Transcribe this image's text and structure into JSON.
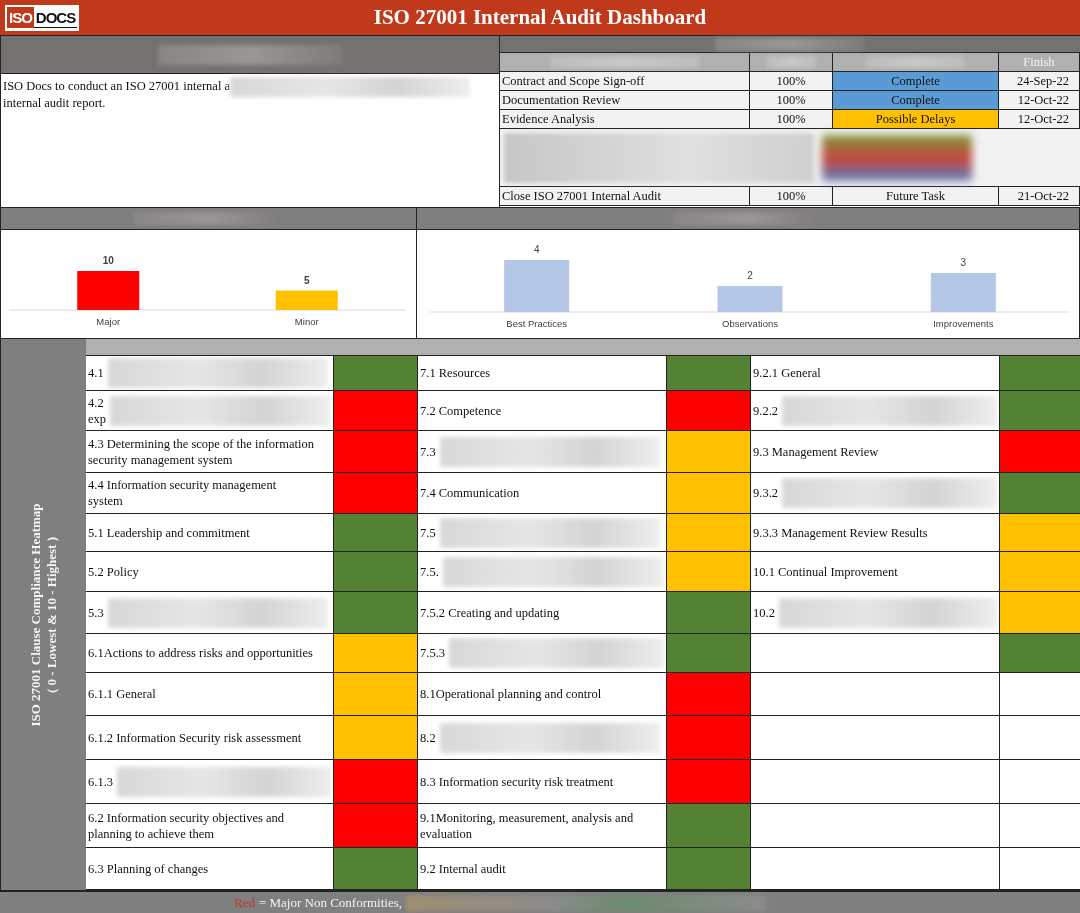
{
  "header": {
    "logo": {
      "mark": "ISO",
      "word": "DOCS"
    },
    "title": "ISO 27001 Internal Audit Dashboard"
  },
  "scope_panel": {
    "title_redacted": true,
    "lines": [
      {
        "text": "ISO Docs to conduct an ISO 27001 internal a",
        "redacted": true
      },
      {
        "text": "internal audit report."
      }
    ]
  },
  "task_table": {
    "title_redacted": true,
    "columns": [
      {
        "redacted": true
      },
      {
        "redacted": true
      },
      {
        "redacted": true
      },
      {
        "label": "Finish"
      }
    ],
    "rows": [
      {
        "kind": "task",
        "task": "Contract and Scope Sign-off",
        "progress": "100%",
        "status": "Complete",
        "color": "#5b9bd5",
        "finish": "24-Sep-22"
      },
      {
        "kind": "task",
        "task": "Documentation Review",
        "progress": "100%",
        "status": "Complete",
        "color": "#5b9bd5",
        "finish": "12-Oct-22"
      },
      {
        "kind": "task",
        "task": "Evidence Analysis",
        "progress": "100%",
        "status": "Possible Delays",
        "color": "#ffc000",
        "finish": "12-Oct-22"
      },
      {
        "kind": "redacted"
      },
      {
        "kind": "task",
        "task": "Close ISO 27001 Internal Audit",
        "progress": "100%",
        "status": "Future Task",
        "finish": "21-Oct-22"
      }
    ]
  },
  "nonconformity_chart": {
    "title_redacted": true,
    "chart_data": {
      "type": "bar",
      "categories": [
        "Major",
        "Minor"
      ],
      "stacked": true,
      "data_labels": true,
      "series": [
        {
          "color": "#ff0000",
          "values": [
            10,
            null
          ]
        },
        {
          "color": "#ffc000",
          "values": [
            null,
            5
          ]
        }
      ]
    }
  },
  "findings_chart": {
    "title_redacted": true,
    "chart_data": {
      "type": "bar",
      "categories": [
        "Best Practices",
        "Observations",
        "Improvements"
      ],
      "data_labels": true,
      "series": [
        {
          "color": "#b4c7e7",
          "values": [
            4,
            2,
            3
          ]
        }
      ]
    }
  },
  "heatmap": {
    "title": "ISO 27001 Clause Compliance Heatmap",
    "subtitle": "( 0 - Lowest & 10 - Highest )",
    "columns": [
      [
        {
          "lines": [
            "4.1"
          ],
          "redacted": true,
          "color": "#548235"
        },
        {
          "lines": [
            "4.2",
            "exp"
          ],
          "redacted": true,
          "color": "#ff0000"
        },
        {
          "lines": [
            "4.3 Determining the scope of the information",
            "security management system"
          ],
          "color": "#ff0000"
        },
        {
          "lines": [
            "4.4 Information security management",
            "system"
          ],
          "color": "#ff0000"
        },
        {
          "lines": [
            "5.1 Leadership and commitment"
          ],
          "color": "#548235"
        },
        {
          "lines": [
            "5.2 Policy"
          ],
          "color": "#548235"
        },
        {
          "lines": [
            "5.3"
          ],
          "redacted": true,
          "color": "#548235"
        },
        {
          "lines": [
            "6.1Actions to address risks and opportunities"
          ],
          "color": "#ffc000"
        },
        {
          "lines": [
            "6.1.1 General"
          ],
          "color": "#ffc000"
        },
        {
          "lines": [
            "6.1.2 Information Security risk assessment"
          ],
          "color": "#ffc000"
        },
        {
          "lines": [
            "6.1.3"
          ],
          "redacted": true,
          "color": "#ff0000"
        },
        {
          "lines": [
            "6.2 Information security objectives and",
            "planning to achieve them"
          ],
          "color": "#ff0000"
        },
        {
          "lines": [
            "6.3 Planning of changes"
          ],
          "color": "#548235"
        }
      ],
      [
        {
          "lines": [
            "7.1 Resources"
          ],
          "color": "#548235"
        },
        {
          "lines": [
            "7.2 Competence"
          ],
          "color": "#ff0000"
        },
        {
          "lines": [
            "7.3"
          ],
          "redacted": true,
          "color": "#ffc000"
        },
        {
          "lines": [
            "7.4 Communication"
          ],
          "color": "#ffc000"
        },
        {
          "lines": [
            "7.5"
          ],
          "redacted": true,
          "color": "#ffc000"
        },
        {
          "lines": [
            "7.5."
          ],
          "redacted": true,
          "color": "#ffc000"
        },
        {
          "lines": [
            "7.5.2 Creating and updating"
          ],
          "color": "#548235"
        },
        {
          "lines": [
            "7.5.3"
          ],
          "redacted": true,
          "color": "#548235"
        },
        {
          "lines": [
            "8.1Operational planning and control"
          ],
          "color": "#ff0000"
        },
        {
          "lines": [
            "8.2"
          ],
          "redacted": true,
          "color": "#ff0000"
        },
        {
          "lines": [
            "8.3 Information security risk treatment"
          ],
          "color": "#ff0000"
        },
        {
          "lines": [
            "9.1Monitoring, measurement, analysis and",
            "evaluation"
          ],
          "color": "#548235"
        },
        {
          "lines": [
            "9.2 Internal audit"
          ],
          "color": "#548235"
        }
      ],
      [
        {
          "lines": [
            "9.2.1 General"
          ],
          "color": "#548235"
        },
        {
          "lines": [
            "9.2.2"
          ],
          "redacted": true,
          "color": "#548235"
        },
        {
          "lines": [
            "9.3 Management Review"
          ],
          "color": "#ff0000"
        },
        {
          "lines": [
            "9.3.2"
          ],
          "redacted": true,
          "color": "#548235"
        },
        {
          "lines": [
            "9.3.3 Management Review Results"
          ],
          "color": "#ffc000"
        },
        {
          "lines": [
            "10.1 Continual Improvement"
          ],
          "color": "#ffc000"
        },
        {
          "lines": [
            "10.2"
          ],
          "redacted": true,
          "color": "#ffc000"
        },
        {
          "color": "#548235"
        },
        {},
        {},
        {},
        {},
        {}
      ]
    ]
  },
  "legend": {
    "color_word": "Red",
    "color": "#c0392b",
    "meaning": "= Major Non Conformities,",
    "redacted": true
  }
}
